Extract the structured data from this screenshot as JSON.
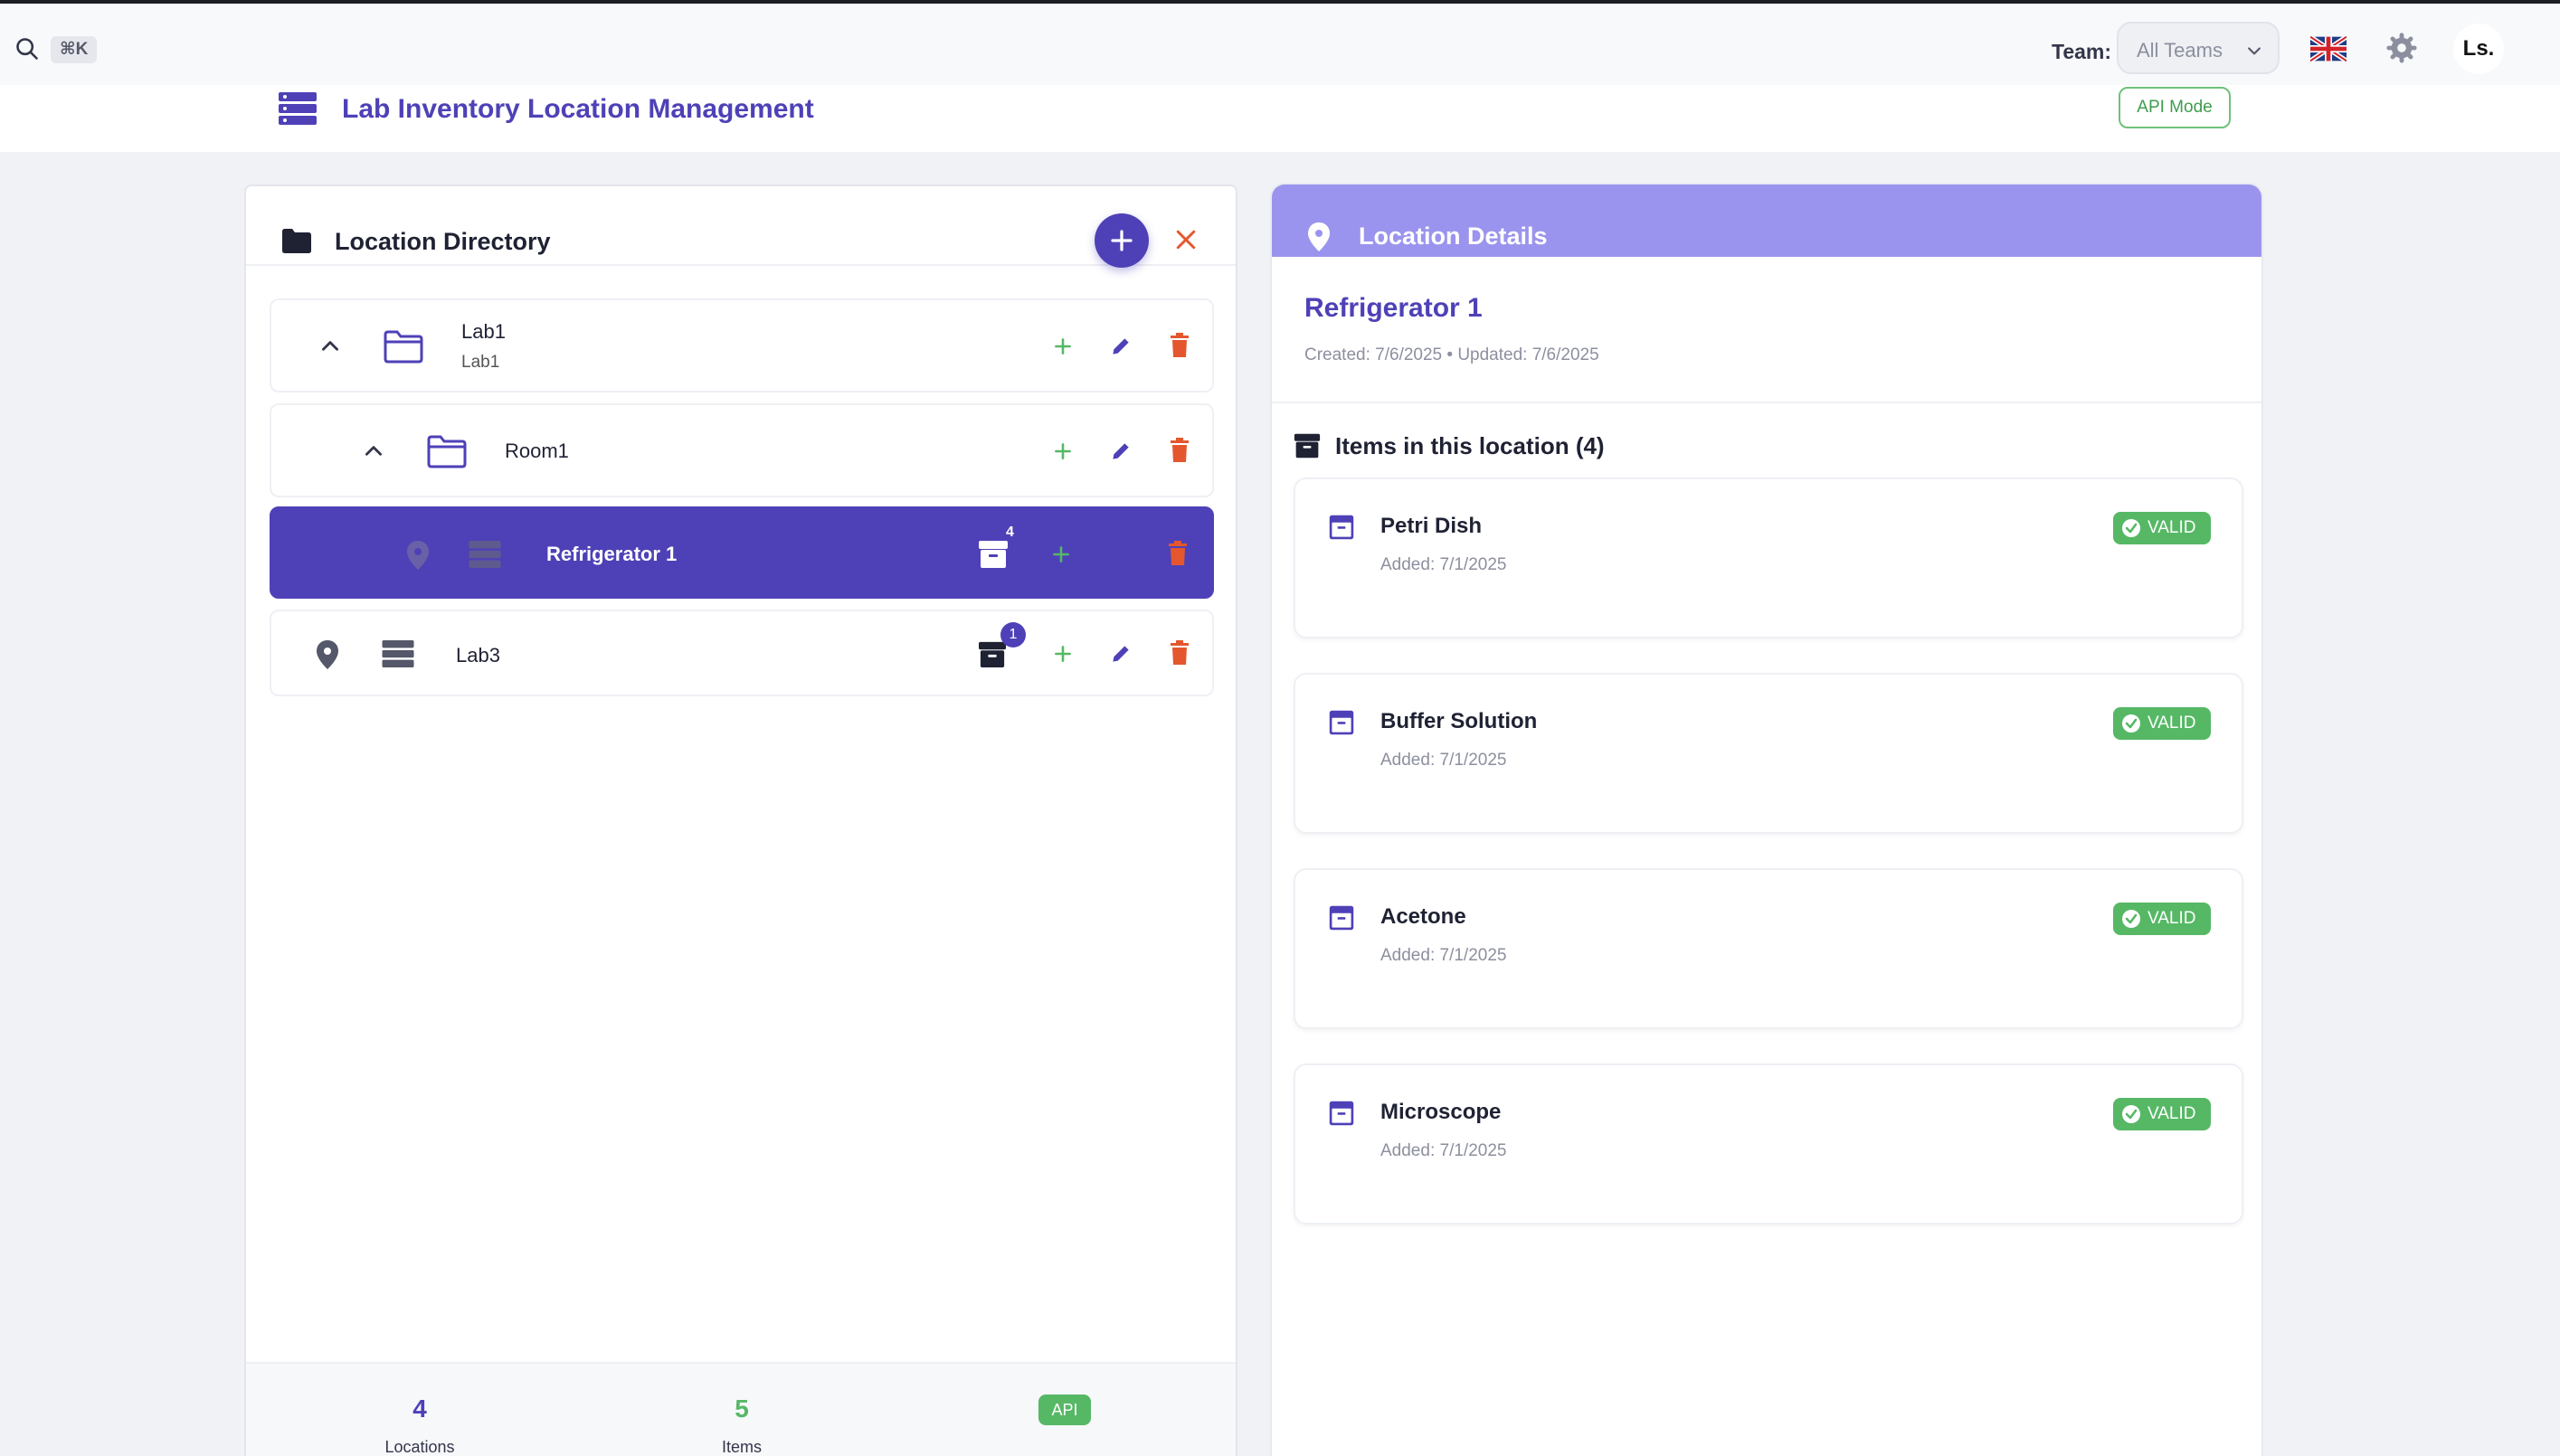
{
  "topbar": {
    "search_shortcut": "⌘K",
    "team_label": "Team:",
    "team_value": "All Teams",
    "avatar_initials": "Ls."
  },
  "header": {
    "title": "Lab Inventory Location Management",
    "api_mode": "API Mode"
  },
  "directory": {
    "title": "Location Directory",
    "rows": [
      {
        "title": "Lab1",
        "subtitle": "Lab1"
      },
      {
        "title": "Room1"
      },
      {
        "title": "Refrigerator 1",
        "badge": "4"
      },
      {
        "title": "Lab3",
        "badge": "1"
      }
    ],
    "stats": {
      "locations_count": "4",
      "locations_label": "Locations",
      "items_count": "5",
      "items_label": "Items",
      "api_badge": "API"
    }
  },
  "details": {
    "title": "Location Details",
    "location_name": "Refrigerator 1",
    "meta": "Created: 7/6/2025 • Updated: 7/6/2025",
    "items_title": "Items in this location (4)",
    "items": [
      {
        "name": "Petri Dish",
        "added": "Added: 7/1/2025",
        "status": "VALID"
      },
      {
        "name": "Buffer Solution",
        "added": "Added: 7/1/2025",
        "status": "VALID"
      },
      {
        "name": "Acetone",
        "added": "Added: 7/1/2025",
        "status": "VALID"
      },
      {
        "name": "Microscope",
        "added": "Added: 7/1/2025",
        "status": "VALID"
      }
    ]
  },
  "colors": {
    "accent": "#4e41b7",
    "header_purple": "#9b94ee",
    "success": "#56b865",
    "danger": "#e4572e"
  }
}
